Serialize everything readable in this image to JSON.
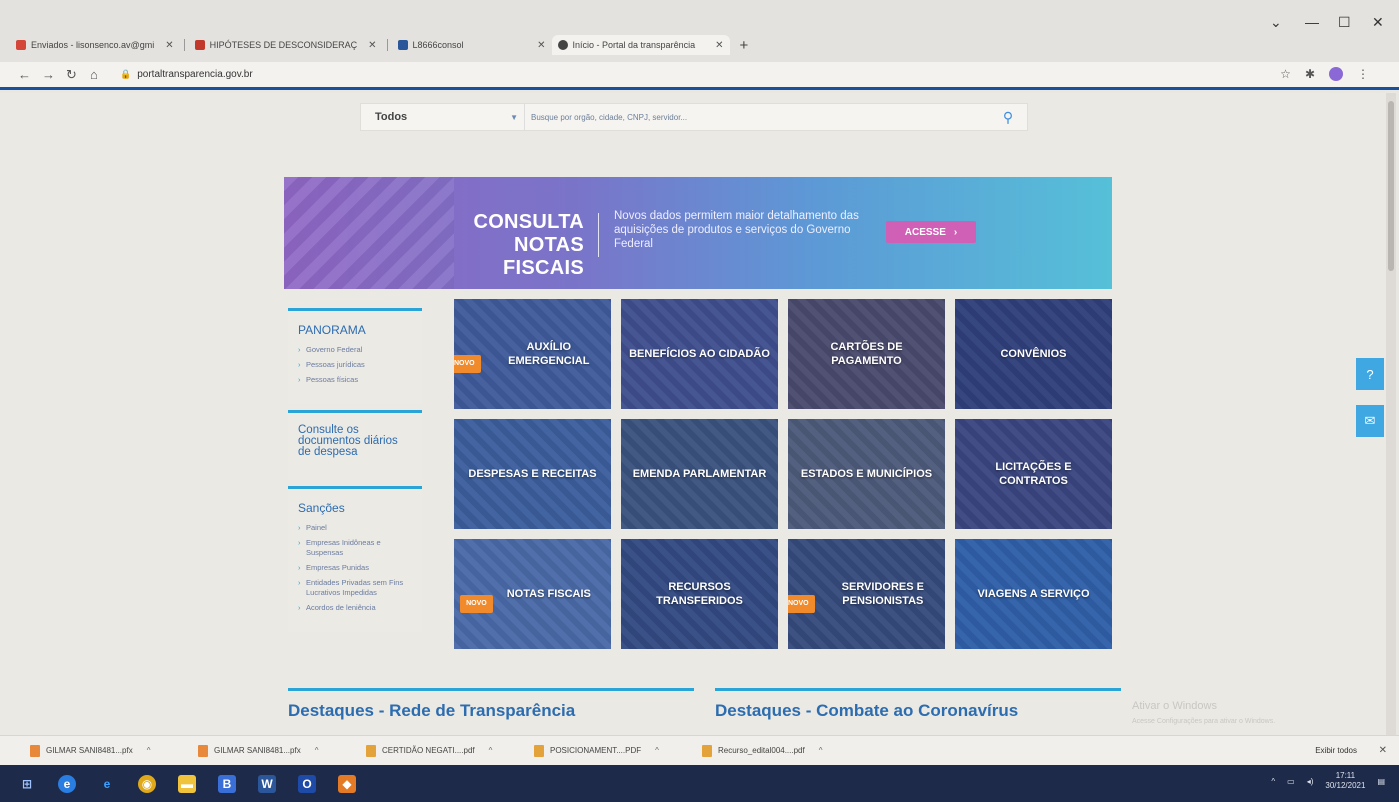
{
  "browser": {
    "tabs": [
      {
        "label": "Enviados - lisonsenco.av@gmi",
        "favicon_color": "#d44638",
        "active": false
      },
      {
        "label": "HIPÓTESES DE DESCONSIDERAÇ",
        "favicon_color": "#c0392b",
        "active": false
      },
      {
        "label": "L8666consol",
        "favicon_color": "#2b579a",
        "active": false
      },
      {
        "label": "Início - Portal da transparência",
        "favicon_color": "#444444",
        "active": true
      }
    ],
    "url": "portaltransparencia.gov.br",
    "window_controls": [
      "⌄",
      "—",
      "☐",
      "✕"
    ]
  },
  "search": {
    "select_value": "Todos",
    "placeholder": "Busque por orgão, cidade, CNPJ, servidor..."
  },
  "banner": {
    "title_line1": "CONSULTA",
    "title_line2": "NOTAS FISCAIS",
    "text": "Novos dados permitem maior detalhamento das aquisições de produtos e serviços do Governo Federal",
    "button": "ACESSE",
    "button_icon": "chevron-right-icon"
  },
  "sidebar": {
    "panorama": {
      "title": "PANORAMA",
      "items": [
        "Governo Federal",
        "Pessoas jurídicas",
        "Pessoas físicas"
      ]
    },
    "consulte": "Consulte os documentos diários de despesa",
    "sancoes": {
      "title": "Sanções",
      "items": [
        "Painel",
        "Empresas Inidôneas e Suspensas",
        "Empresas Punidas",
        "Entidades Privadas sem Fins Lucrativos Impedidas",
        "Acordos de leniência"
      ]
    }
  },
  "tiles": [
    {
      "label": "AUXÍLIO EMERGENCIAL",
      "badge": "NOVO",
      "color": "#3e5b9a"
    },
    {
      "label": "BENEFÍCIOS AO CIDADÃO",
      "badge": "",
      "color": "#3f4f8e"
    },
    {
      "label": "CARTÕES DE PAGAMENTO",
      "badge": "",
      "color": "#4a4a6e"
    },
    {
      "label": "CONVÊNIOS",
      "badge": "",
      "color": "#2f3f7a"
    },
    {
      "label": "DESPESAS E RECEITAS",
      "badge": "",
      "color": "#3b5e9c"
    },
    {
      "label": "EMENDA PARLAMENTAR",
      "badge": "",
      "color": "#3a527e"
    },
    {
      "label": "ESTADOS E MUNICÍPIOS",
      "badge": "",
      "color": "#4d5a7a"
    },
    {
      "label": "LICITAÇÕES E CONTRATOS",
      "badge": "",
      "color": "#3a4680"
    },
    {
      "label": "NOTAS FISCAIS",
      "badge": "NOVO",
      "color": "#4a6aa8"
    },
    {
      "label": "RECURSOS TRANSFERIDOS",
      "badge": "",
      "color": "#324a82"
    },
    {
      "label": "SERVIDORES E PENSIONISTAS",
      "badge": "NOVO",
      "color": "#364b7c"
    },
    {
      "label": "VIAGENS A SERVIÇO",
      "badge": "",
      "color": "#2f5fa8"
    }
  ],
  "highlights": {
    "left": "Destaques - Rede de Transparência",
    "right": "Destaques - Combate ao Coronavírus"
  },
  "watermark": {
    "line1": "Ativar o Windows",
    "line2": "Acesse Configurações para ativar o Windows."
  },
  "downloads": {
    "items": [
      "GILMAR SANI8481...pfx",
      "GILMAR SANI8481...pfx",
      "CERTIDÃO NEGATI....pdf",
      "POSICIONAMENT....PDF",
      "Recurso_edital004....pdf"
    ],
    "show_all": "Exibir todos"
  },
  "taskbar": {
    "time": "17:11",
    "date": "30/12/2021"
  },
  "colors": {
    "accent": "#2aa3d6",
    "link": "#2c6cb0",
    "badge": "#f08a2a",
    "banner_button": "#d05fb6"
  }
}
